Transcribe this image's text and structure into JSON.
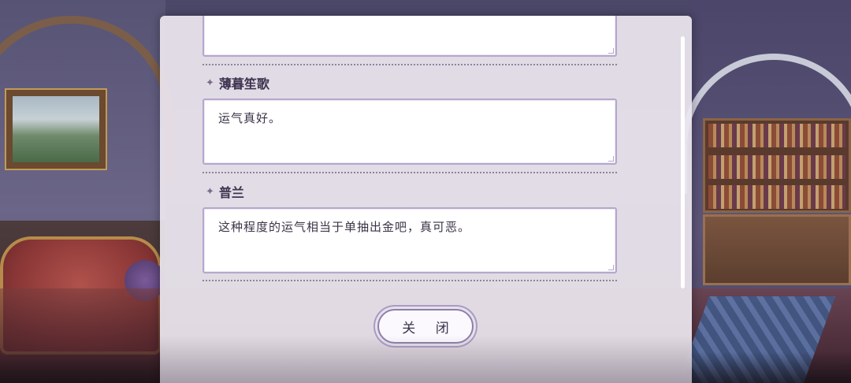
{
  "dialog": {
    "messages": [
      {
        "speaker": "",
        "text": ""
      },
      {
        "speaker": "薄暮笙歌",
        "text": "运气真好。"
      },
      {
        "speaker": "普兰",
        "text": "这种程度的运气相当于单抽出金吧，真可恶。"
      }
    ],
    "close_label": "关 闭"
  },
  "icons": {
    "speaker_marker": "sparkle-icon"
  },
  "colors": {
    "panel_bg": "#ece6ee",
    "box_border": "#b5a8cc",
    "text": "#3e3450"
  }
}
